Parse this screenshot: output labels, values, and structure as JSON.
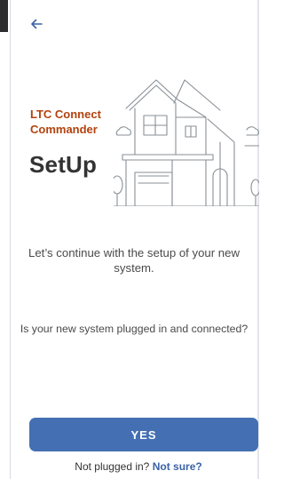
{
  "header": {
    "back_icon": "arrow-left-icon",
    "accent_color": "#3a62a6"
  },
  "brand": {
    "line1": "LTC Connect",
    "line2": "Commander",
    "color": "#b3420e"
  },
  "page": {
    "title": "SetUp",
    "illustration": "house-icon"
  },
  "content": {
    "message": "Let’s continue with the setup of your new system.",
    "question": "Is your new system plugged in and connected?"
  },
  "actions": {
    "yes_label": "YES",
    "button_color": "#4470b3"
  },
  "footer": {
    "prompt": "Not plugged in?",
    "link_label": "Not sure?"
  }
}
